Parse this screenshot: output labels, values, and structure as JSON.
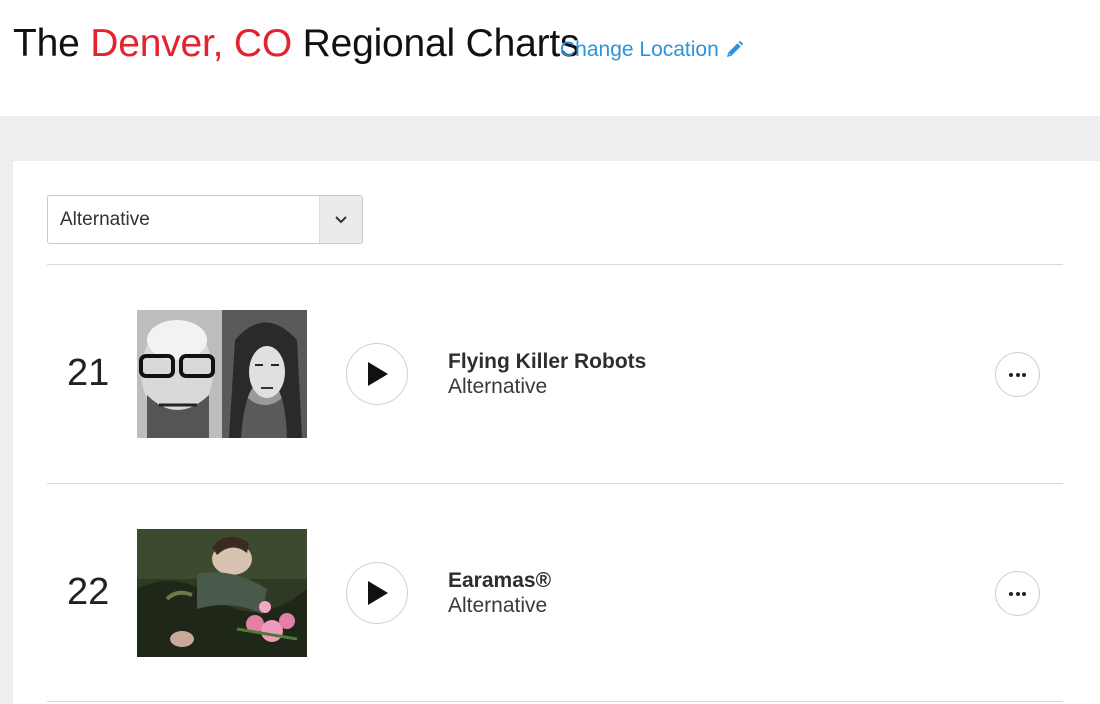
{
  "header": {
    "title_prefix": "The",
    "location": "Denver, CO",
    "title_suffix": "Regional Charts",
    "change_location_label": "Change Location",
    "accent_color": "#e3232f",
    "link_color": "#2c94d9",
    "edit_icon": "pencil-icon"
  },
  "genre_select": {
    "selected": "Alternative",
    "icon": "chevron-down-icon"
  },
  "chart_entries": [
    {
      "rank": "21",
      "artist": "Flying Killer Robots",
      "genre": "Alternative",
      "play_icon": "play-icon",
      "more_icon": "more-options-icon"
    },
    {
      "rank": "22",
      "artist": "Earamas®",
      "genre": "Alternative",
      "play_icon": "play-icon",
      "more_icon": "more-options-icon"
    }
  ]
}
